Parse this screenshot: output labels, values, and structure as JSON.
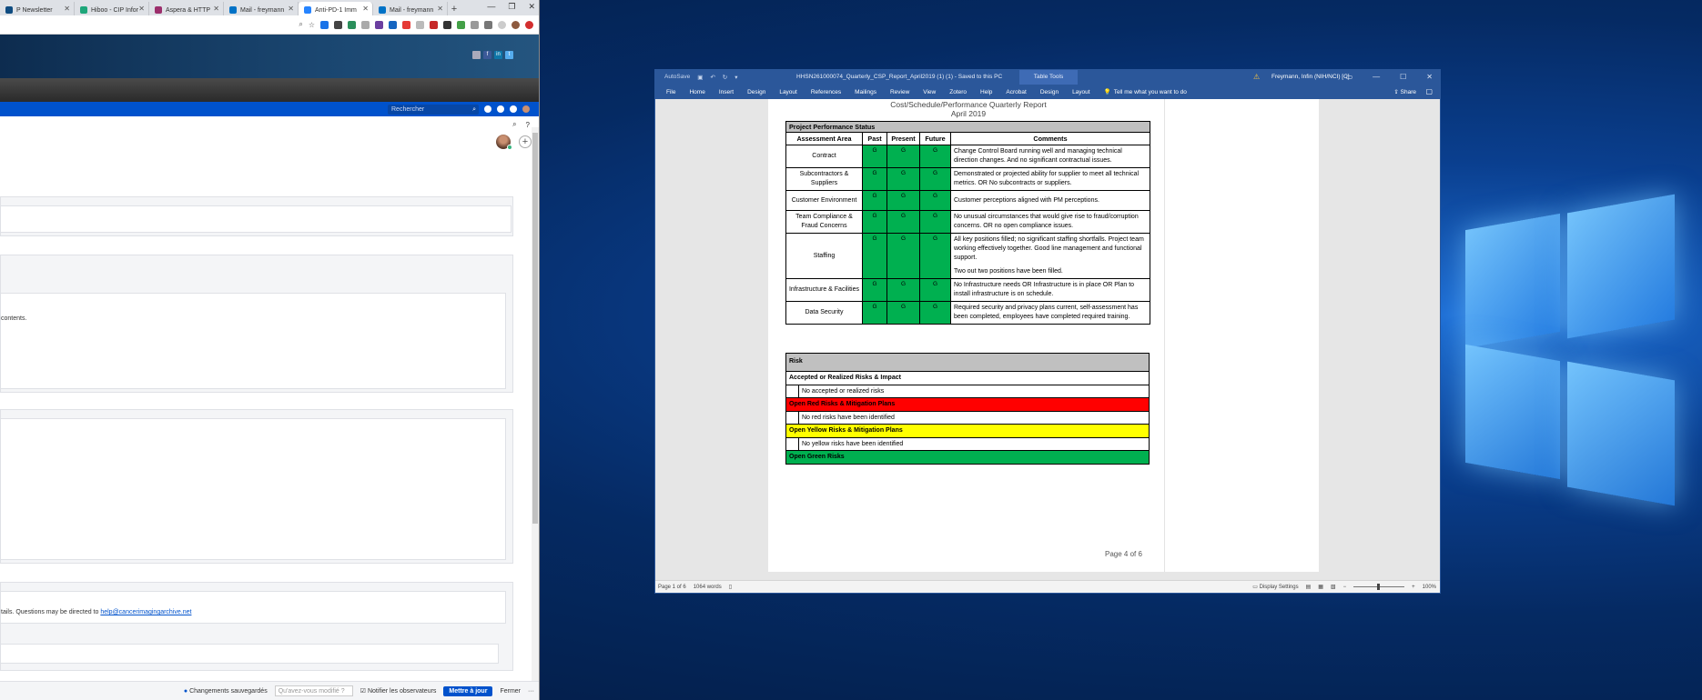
{
  "browser": {
    "tabs": [
      {
        "label": "P Newsletter",
        "color": "#0f4c81"
      },
      {
        "label": "Hiboo - CIP Infor",
        "color": "#1ea67a"
      },
      {
        "label": "Aspera & HTTP",
        "color": "#9c2f6c"
      },
      {
        "label": "Mail - freymann",
        "color": "#0072c6"
      },
      {
        "label": "Anti-PD-1 Imm",
        "color": "#2684ff",
        "active": true
      },
      {
        "label": "Mail - freymann",
        "color": "#0072c6"
      }
    ],
    "new_tab": "+",
    "jira_search_placeholder": "Rechercher",
    "content_text_1": "contents.",
    "content_text_2": "tails. Questions may be directed to ",
    "content_link": "help@cancerimagingarchive.net",
    "footer": {
      "saved": "Changements sauvegardés",
      "what_changed_placeholder": "Qu'avez-vous modifié ?",
      "notify": "Notifier les observateurs",
      "update": "Mettre à jour",
      "close": "Fermer",
      "more": "···"
    }
  },
  "word": {
    "title": {
      "autosave": "AutoSave",
      "document": "HHSN261000074_Quarterly_CSP_Report_April2019 (1) (1) - Saved to this PC",
      "table_tools": "Table Tools",
      "user": "Freymann, Infin (NIH/NCI) [C]"
    },
    "ribbon": [
      "File",
      "Home",
      "Insert",
      "Design",
      "Layout",
      "References",
      "Mailings",
      "Review",
      "View",
      "Zotero",
      "Help",
      "Acrobat",
      "Design",
      "Layout"
    ],
    "tell_me": "Tell me what you want to do",
    "share": "Share",
    "doc": {
      "heading1": "Cost/Schedule/Performance Quarterly Report",
      "heading2": "April 2019",
      "table_title": "Project Performance Status",
      "col_area": "Assessment Area",
      "col_past": "Past",
      "col_present": "Present",
      "col_future": "Future",
      "col_comments": "Comments",
      "rows": [
        {
          "area": "Contract",
          "past": "G",
          "present": "G",
          "future": "G",
          "comment": "Change Control Board running well and managing technical direction changes. And no significant contractual issues."
        },
        {
          "area": "Subcontractors & Suppliers",
          "past": "G",
          "present": "G",
          "future": "G",
          "comment": "Demonstrated or projected ability for supplier to meet all technical metrics. OR No subcontracts or suppliers."
        },
        {
          "area": "Customer Environment",
          "past": "G",
          "present": "G",
          "future": "G",
          "comment": "Customer perceptions aligned with PM perceptions."
        },
        {
          "area": "Team Compliance & Fraud Concerns",
          "past": "G",
          "present": "G",
          "future": "G",
          "comment": "No unusual circumstances that would give rise to fraud/corruption concerns. OR no open compliance issues."
        },
        {
          "area": "Staffing",
          "past": "G",
          "present": "G",
          "future": "G",
          "comment": "All key positions filled; no significant staffing shortfalls. Project team working effectively together. Good line management and functional support.",
          "comment2": "Two out two positions have been filled."
        },
        {
          "area": "Infrastructure & Facilities",
          "past": "G",
          "present": "G",
          "future": "G",
          "comment": "No Infrastructure needs OR Infrastructure is in place OR Plan to install infrastructure is on schedule."
        },
        {
          "area": "Data Security",
          "past": "G",
          "present": "G",
          "future": "G",
          "comment": "Required security and privacy plans current, self-assessment has been completed, employees have completed required training."
        }
      ],
      "risk": {
        "title": "Risk",
        "accepted_head": "Accepted or Realized Risks & Impact",
        "accepted_text": "No accepted or realized risks",
        "red_head": "Open Red Risks & Mitigation Plans",
        "red_text": "No red risks have been identified",
        "yellow_head": "Open Yellow Risks & Mitigation Plans",
        "yellow_text": "No yellow risks have been identified",
        "green_head": "Open Green Risks"
      },
      "page_footer": "Page 4 of 6"
    },
    "status": {
      "page": "Page 1 of 6",
      "words": "1064 words",
      "display": "Display Settings",
      "zoom": "100%"
    }
  }
}
